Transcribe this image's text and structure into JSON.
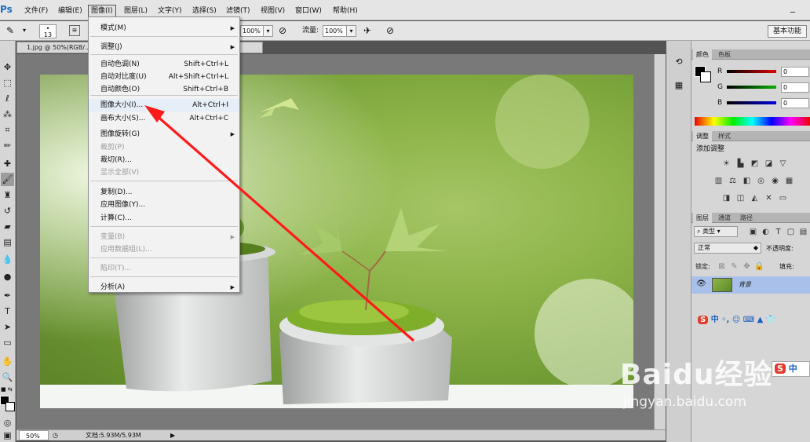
{
  "app": {
    "logo": "Ps"
  },
  "menubar": {
    "items": [
      "文件(F)",
      "编辑(E)",
      "图像(I)",
      "图层(L)",
      "文字(Y)",
      "选择(S)",
      "滤镜(T)",
      "视图(V)",
      "窗口(W)",
      "帮助(H)"
    ],
    "win_ctrl": "_"
  },
  "options": {
    "brush_size": "13",
    "pct1": "100%",
    "flow_label": "流量:",
    "pct2": "100%",
    "workspace": "基本功能"
  },
  "doc": {
    "tab": "1.jpg @ 50%(RGB/...",
    "zoom": "50%",
    "status": "文档:5.93M/5.93M"
  },
  "dropdown": {
    "items": [
      {
        "label": "模式(M)",
        "shortcut": "",
        "arrow": "▶",
        "disabled": false
      },
      {
        "label": "调整(J)",
        "shortcut": "",
        "arrow": "▶",
        "disabled": false
      },
      {
        "label": "自动色调(N)",
        "shortcut": "Shift+Ctrl+L",
        "arrow": "",
        "disabled": false
      },
      {
        "label": "自动对比度(U)",
        "shortcut": "Alt+Shift+Ctrl+L",
        "arrow": "",
        "disabled": false
      },
      {
        "label": "自动颜色(O)",
        "shortcut": "Shift+Ctrl+B",
        "arrow": "",
        "disabled": false
      },
      {
        "label": "图像大小(I)...",
        "shortcut": "Alt+Ctrl+I",
        "arrow": "",
        "disabled": false
      },
      {
        "label": "画布大小(S)...",
        "shortcut": "Alt+Ctrl+C",
        "arrow": "",
        "disabled": false
      },
      {
        "label": "图像旋转(G)",
        "shortcut": "",
        "arrow": "▶",
        "disabled": false
      },
      {
        "label": "裁剪(P)",
        "shortcut": "",
        "arrow": "",
        "disabled": true
      },
      {
        "label": "裁切(R)...",
        "shortcut": "",
        "arrow": "",
        "disabled": false
      },
      {
        "label": "显示全部(V)",
        "shortcut": "",
        "arrow": "",
        "disabled": true
      },
      {
        "label": "复制(D)...",
        "shortcut": "",
        "arrow": "",
        "disabled": false
      },
      {
        "label": "应用图像(Y)...",
        "shortcut": "",
        "arrow": "",
        "disabled": false
      },
      {
        "label": "计算(C)...",
        "shortcut": "",
        "arrow": "",
        "disabled": false
      },
      {
        "label": "变量(B)",
        "shortcut": "",
        "arrow": "▶",
        "disabled": true
      },
      {
        "label": "应用数据组(L)...",
        "shortcut": "",
        "arrow": "",
        "disabled": true
      },
      {
        "label": "陷印(T)...",
        "shortcut": "",
        "arrow": "",
        "disabled": true
      },
      {
        "label": "分析(A)",
        "shortcut": "",
        "arrow": "▶",
        "disabled": false
      }
    ]
  },
  "color_panel": {
    "tabs": [
      "颜色",
      "色板"
    ],
    "channels": [
      "R",
      "G",
      "B"
    ],
    "values": [
      "0",
      "0",
      "0"
    ],
    "channel_colors": [
      "#e00000",
      "#00b000",
      "#0000e0"
    ]
  },
  "adjust_panel": {
    "tabs": [
      "调整",
      "样式"
    ],
    "title": "添加调整"
  },
  "layers_panel": {
    "tabs": [
      "图层",
      "通道",
      "路径"
    ],
    "kind": "类型",
    "blend": "正常",
    "opacity_label": "不透明度:",
    "lock_label": "锁定:",
    "fill_label": "填充:",
    "layer_name": "背景"
  },
  "ime": {
    "row1": "中 ◦, ☺ ⌨ ▲ 👕",
    "row2": "中"
  },
  "watermark": {
    "brand": "Baidu经验",
    "url": "jingyan.baidu.com"
  },
  "icons": [
    "brush-icon",
    "move-icon",
    "marquee-icon",
    "lasso-icon",
    "quick-select-icon",
    "crop-icon",
    "eyedropper-icon",
    "healing-icon",
    "brush-tool-icon",
    "stamp-icon",
    "history-brush-icon",
    "eraser-icon",
    "gradient-icon",
    "blur-icon",
    "dodge-icon",
    "pen-icon",
    "type-icon",
    "path-select-icon",
    "shape-icon",
    "hand-icon",
    "zoom-icon",
    "eye-icon"
  ]
}
